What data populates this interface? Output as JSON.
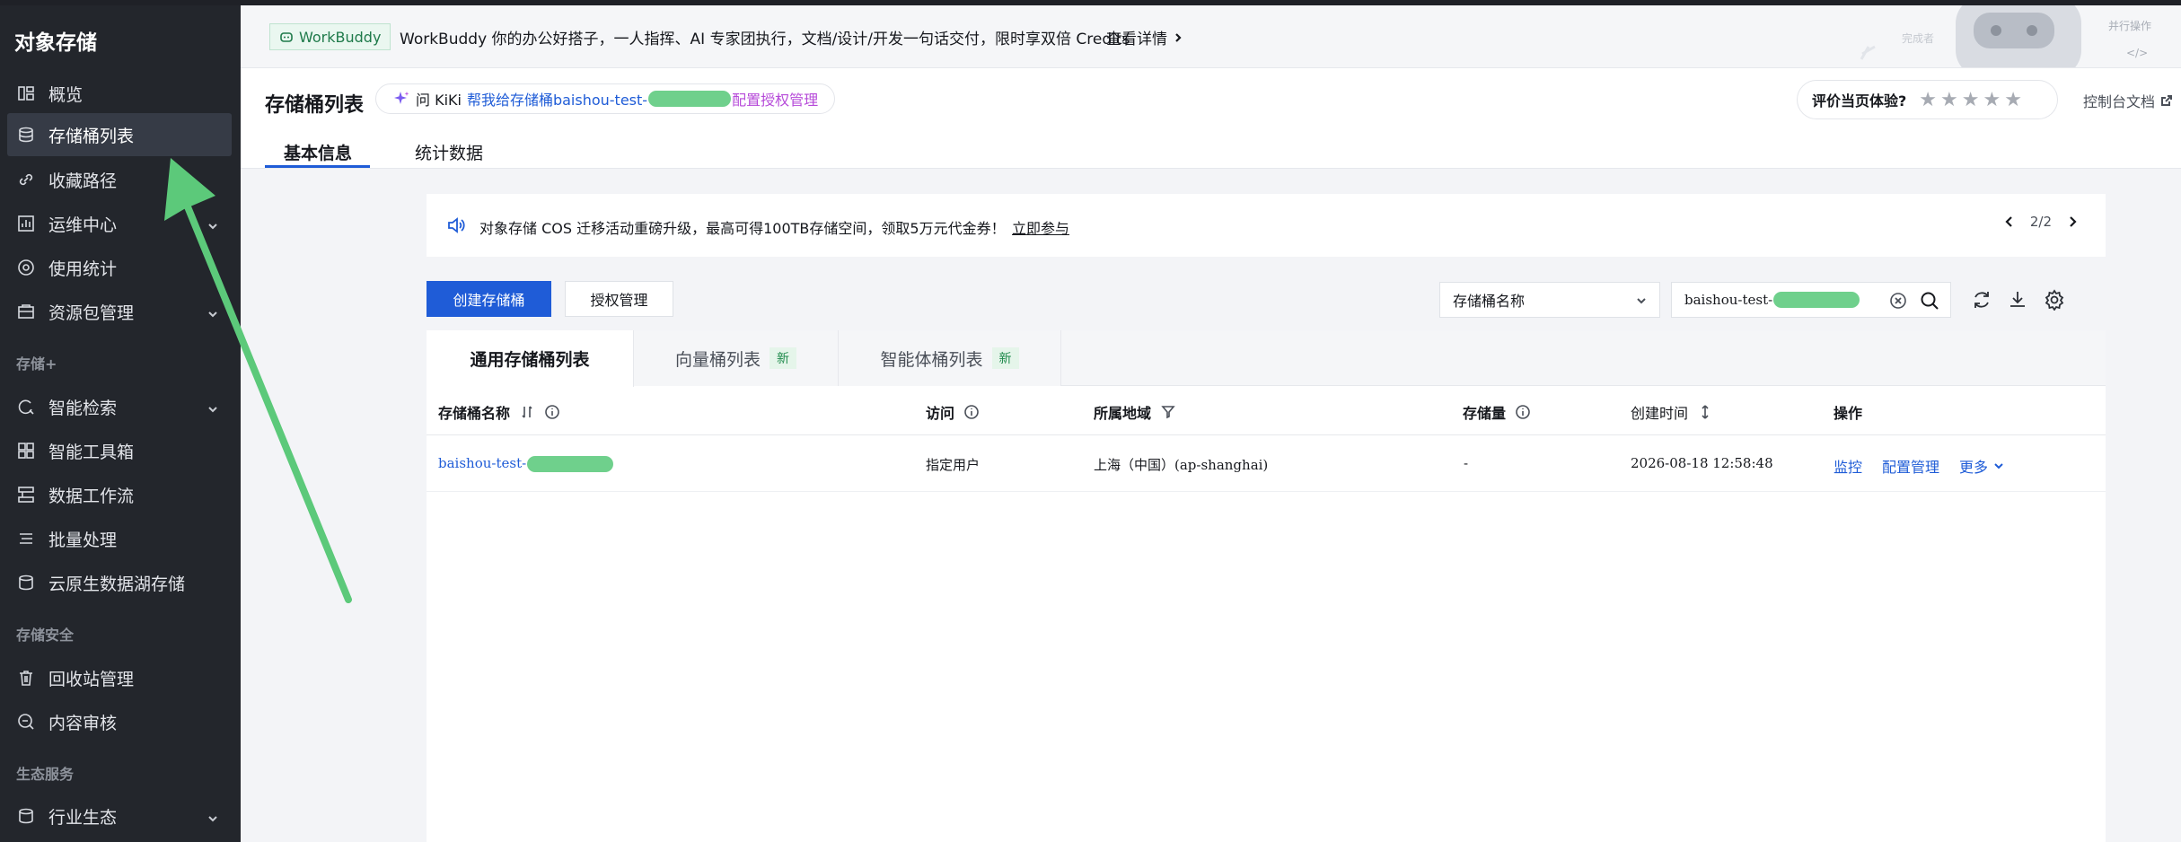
{
  "sidebar": {
    "title": "对象存储",
    "items": [
      {
        "label": "概览",
        "icon": "overview-icon"
      },
      {
        "label": "存储桶列表",
        "icon": "bucket-icon"
      },
      {
        "label": "收藏路径",
        "icon": "link-icon"
      },
      {
        "label": "运维中心",
        "icon": "chart-icon"
      },
      {
        "label": "使用统计",
        "icon": "stats-icon"
      },
      {
        "label": "资源包管理",
        "icon": "package-icon"
      },
      {
        "label": "智能检索",
        "icon": "ai-search-icon"
      },
      {
        "label": "智能工具箱",
        "icon": "toolbox-icon"
      },
      {
        "label": "数据工作流",
        "icon": "workflow-icon"
      },
      {
        "label": "批量处理",
        "icon": "batch-icon"
      },
      {
        "label": "云原生数据湖存储",
        "icon": "datalake-icon"
      },
      {
        "label": "回收站管理",
        "icon": "trash-icon"
      },
      {
        "label": "内容审核",
        "icon": "review-icon"
      },
      {
        "label": "行业生态",
        "icon": "ecosystem-icon"
      }
    ],
    "sections": [
      "存储+",
      "存储安全",
      "生态服务"
    ]
  },
  "banner": {
    "badge": "WorkBuddy",
    "text": "WorkBuddy 你的办公好搭子，一人指挥、AI 专家团执行，文档/设计/开发一句话交付，限时享双倍 Credits",
    "link": "查看详情",
    "deco_1": "并行操作",
    "deco_2": "</>",
    "deco_3": "完成者"
  },
  "header": {
    "title": "存储桶列表",
    "kiki_prefix": "问 KiKi",
    "kiki_link": "帮我给存储桶baishou-test-",
    "kiki_action": "配置授权管理",
    "rate_label": "评价当页体验?",
    "stars": [
      "★",
      "★",
      "★",
      "★",
      "★"
    ],
    "docs": "控制台文档",
    "tabs": [
      "基本信息",
      "统计数据"
    ]
  },
  "notice": {
    "text": "对象存储 COS 迁移活动重磅升级，最高可得100TB存储空间，领取5万元代金券！",
    "link": "立即参与",
    "page": "2/2"
  },
  "toolbar": {
    "create": "创建存储桶",
    "auth": "授权管理",
    "select": "存储桶名称",
    "search_value": "baishou-test-"
  },
  "table": {
    "tabs": [
      {
        "label": "通用存储桶列表"
      },
      {
        "label": "向量桶列表",
        "tag": "新"
      },
      {
        "label": "智能体桶列表",
        "tag": "新"
      }
    ],
    "columns": [
      "存储桶名称",
      "访问",
      "所属地域",
      "存储量",
      "创建时间",
      "操作"
    ],
    "rows": [
      {
        "name": "baishou-test-",
        "access": "指定用户",
        "region": "上海（中国）(ap-shanghai)",
        "size": "-",
        "created": "2026-08-18 12:58:48",
        "ops": [
          "监控",
          "配置管理",
          "更多"
        ]
      }
    ]
  },
  "colors": {
    "accent": "#1f5cd7",
    "sidebar_bg": "#23262c",
    "annotation_arrow": "#5cc97a"
  }
}
